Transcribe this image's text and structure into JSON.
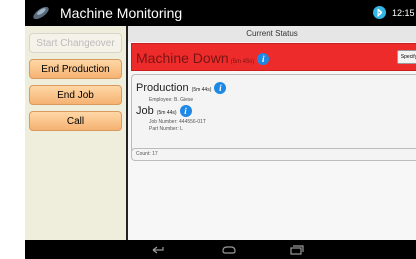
{
  "app": {
    "title": "Machine Monitoring"
  },
  "status_bar": {
    "time": "12:15"
  },
  "left_panel": {
    "buttons": [
      {
        "label": "Start Changeover",
        "enabled": false
      },
      {
        "label": "End Production",
        "enabled": true
      },
      {
        "label": "End Job",
        "enabled": true
      },
      {
        "label": "Call",
        "enabled": true
      }
    ]
  },
  "right_panel": {
    "header": "Current Status",
    "machine_status": {
      "title": "Machine Down",
      "duration": "(5m 45s)",
      "action_label": "Specify"
    },
    "production": {
      "title": "Production",
      "duration": "(5m 44s)",
      "employee": "Employee: B. Giese"
    },
    "job": {
      "title": "Job",
      "duration": "(5m 44s)",
      "job_number": "Job Number: 444556-01T",
      "part_number": "Part Number: L"
    },
    "count": "Count: 17"
  },
  "icons": {
    "app": "app-logo-icon",
    "status": "bluetooth-icon",
    "info": "info-icon",
    "nav": [
      "back-icon",
      "home-icon",
      "recent-apps-icon"
    ]
  },
  "colors": {
    "action_bar": "#000000",
    "left_panel": "#efeedd",
    "button_orange": "#f5b272",
    "machine_down": "#ee2b2b",
    "info_blue": "#1e88e5",
    "status_icon": "#33b5e5"
  }
}
